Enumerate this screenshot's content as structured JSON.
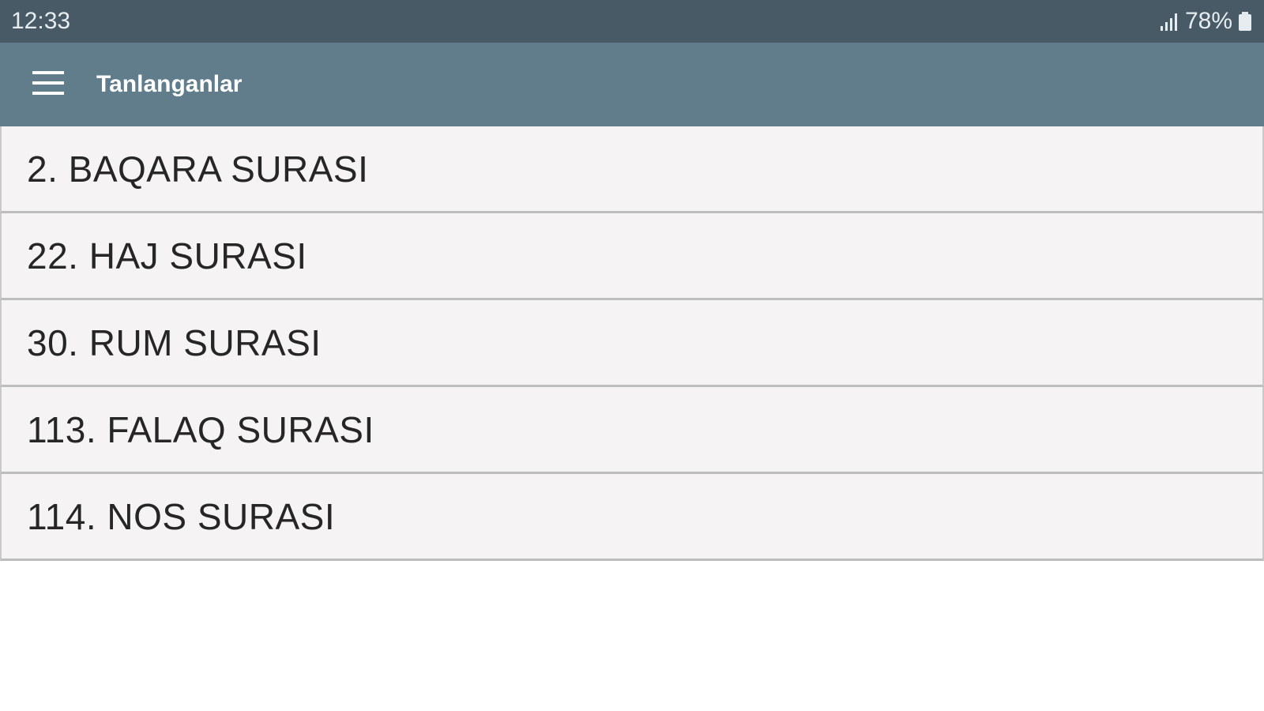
{
  "status_bar": {
    "time": "12:33",
    "battery_percent": "78%",
    "signal_icon": "signal-bars-icon",
    "battery_icon": "battery-icon"
  },
  "app_bar": {
    "menu_icon": "hamburger-menu-icon",
    "title": "Tanlanganlar",
    "background_color": "#617d8c"
  },
  "list": {
    "items": [
      {
        "label": "2. BAQARA SURASI"
      },
      {
        "label": "22. HAJ SURASI"
      },
      {
        "label": "30. RUM SURASI"
      },
      {
        "label": "113. FALAQ SURASI"
      },
      {
        "label": "114. NOS SURASI"
      }
    ]
  }
}
